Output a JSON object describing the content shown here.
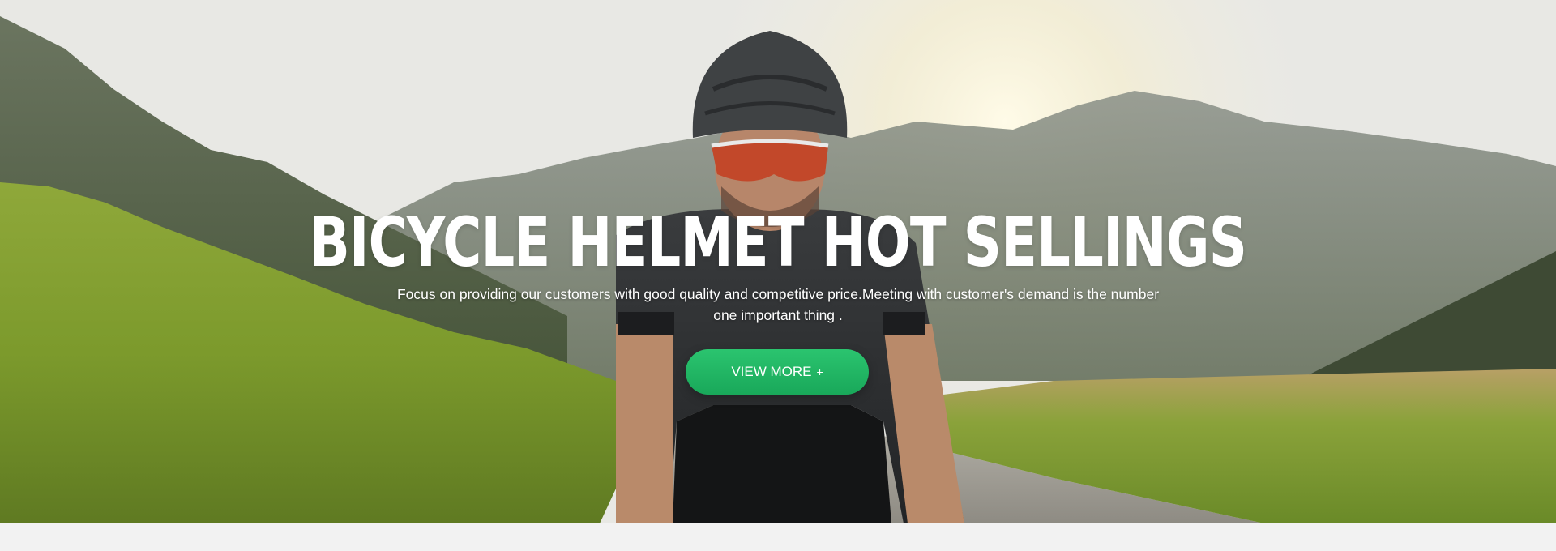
{
  "hero": {
    "headline": "BICYCLE HELMET HOT SELLINGS",
    "description": "Focus on providing our customers with good quality and competitive price.Meeting with customer's demand is the number one important thing .",
    "cta_label": "VIEW MORE",
    "cta_icon": "+",
    "image_subject": "cyclist-with-helmet-mountain-road"
  },
  "colors": {
    "accent": "#1fb563",
    "headline": "#ffffff",
    "page_background": "#f2f2f2"
  }
}
